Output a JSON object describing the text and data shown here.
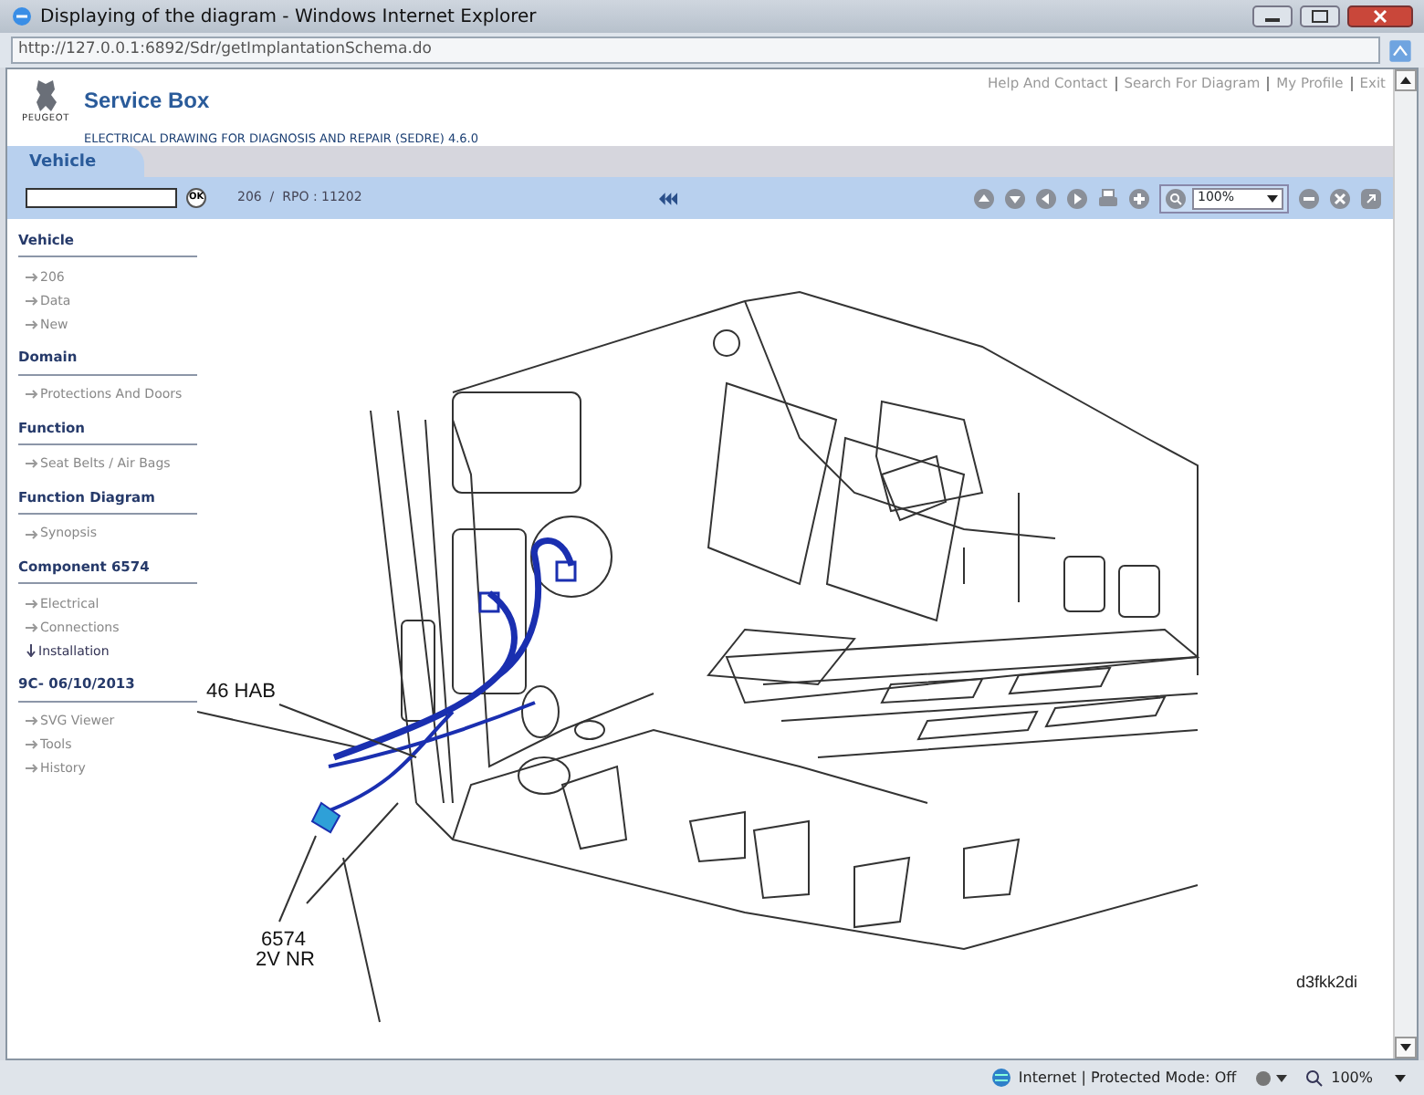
{
  "window": {
    "title": "Displaying of the diagram - Windows Internet Explorer",
    "address": "http://127.0.0.1:6892/Sdr/getImplantationSchema.do"
  },
  "header": {
    "brand": "PEUGEOT",
    "title": "Service Box",
    "subtitle": "ELECTRICAL DRAWING FOR DIAGNOSIS AND REPAIR (SEDRE) 4.6.0",
    "links": [
      "Help And Contact",
      "Search For Diagram",
      "My Profile",
      "Exit"
    ]
  },
  "tabs": [
    {
      "label": "Vehicle",
      "selected": true
    }
  ],
  "toolbar": {
    "search_button": "OK",
    "breadcrumb": "206  /  RPO : 11202",
    "zoom": "100%"
  },
  "sidebar": [
    {
      "heading": "Vehicle",
      "items": [
        {
          "label": "206",
          "selected": false
        },
        {
          "label": "Data",
          "selected": false
        },
        {
          "label": "New",
          "selected": false
        }
      ]
    },
    {
      "heading": "Domain",
      "items": [
        {
          "label": "Protections And Doors",
          "selected": false
        }
      ]
    },
    {
      "heading": "Function",
      "items": [
        {
          "label": "Seat Belts / Air Bags",
          "selected": false
        }
      ]
    },
    {
      "heading": "Function Diagram",
      "items": [
        {
          "label": "Synopsis",
          "selected": false
        }
      ]
    },
    {
      "heading": "Component 6574",
      "items": [
        {
          "label": "Electrical",
          "selected": false
        },
        {
          "label": "Connections",
          "selected": false
        },
        {
          "label": "Installation",
          "selected": true
        }
      ]
    },
    {
      "heading": "9C- 06/10/2013",
      "items": [
        {
          "label": "SVG Viewer",
          "selected": false
        },
        {
          "label": "Tools",
          "selected": false
        },
        {
          "label": "History",
          "selected": false
        }
      ]
    }
  ],
  "diagram": {
    "labels": [
      {
        "text": "46 HAB"
      },
      {
        "text": "6574"
      },
      {
        "text": "2V NR"
      }
    ],
    "reference": "d3fkk2di"
  },
  "status_bar": {
    "zone": "Internet | Protected Mode: Off",
    "zoom": "100%"
  }
}
